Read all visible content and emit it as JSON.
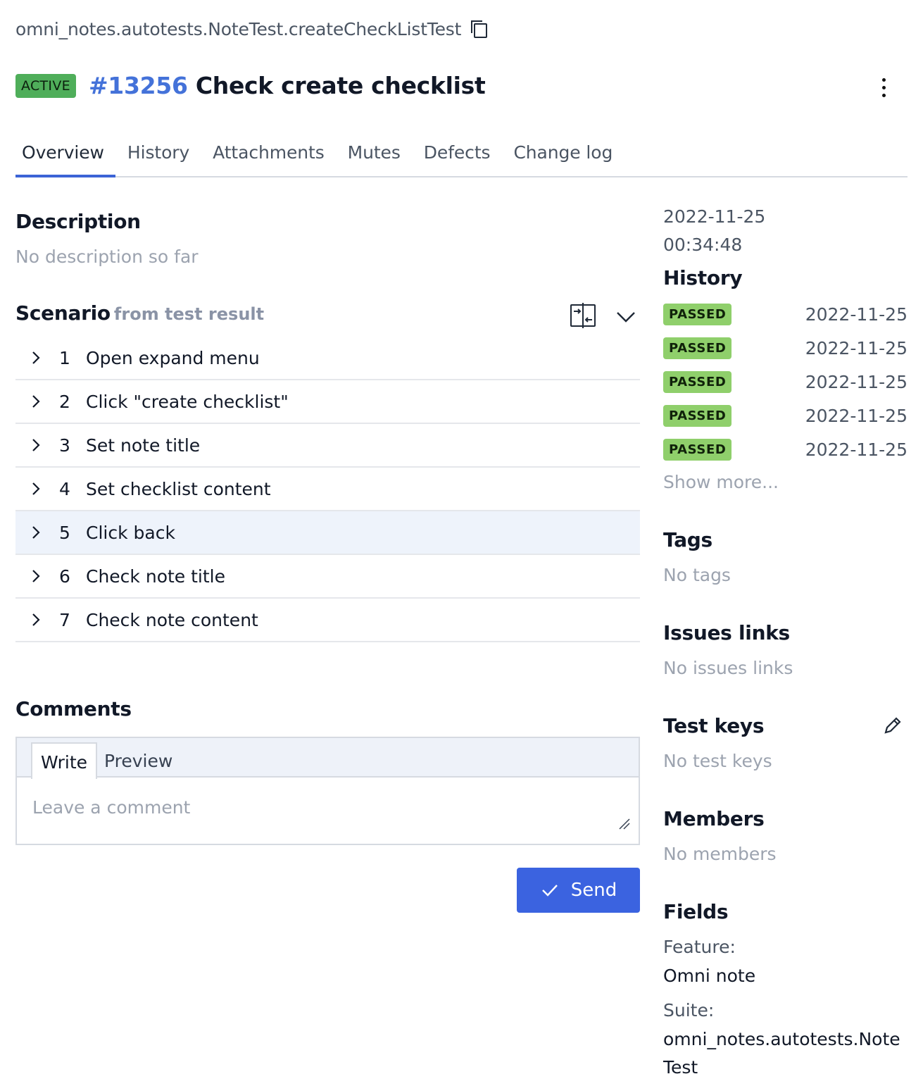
{
  "breadcrumb": {
    "path": "omni_notes.autotests.NoteTest.createCheckListTest",
    "copy_icon": "copy-icon"
  },
  "header": {
    "status": "ACTIVE",
    "id": "#13256",
    "title": "Check create checklist",
    "menu_icon": "more-vertical-icon"
  },
  "tabs": [
    "Overview",
    "History",
    "Attachments",
    "Mutes",
    "Defects",
    "Change log"
  ],
  "active_tab": "Overview",
  "description": {
    "title": "Description",
    "empty": "No description so far"
  },
  "scenario": {
    "title": "Scenario",
    "subtitle": "from test result",
    "steps": [
      {
        "num": "1",
        "label": "Open expand menu"
      },
      {
        "num": "2",
        "label": "Click \"create checklist\""
      },
      {
        "num": "3",
        "label": "Set note title"
      },
      {
        "num": "4",
        "label": "Set checklist content"
      },
      {
        "num": "5",
        "label": "Click back"
      },
      {
        "num": "6",
        "label": "Check note title"
      },
      {
        "num": "7",
        "label": "Check note content"
      }
    ],
    "highlighted_step": "5"
  },
  "comments": {
    "title": "Comments",
    "write_tab": "Write",
    "preview_tab": "Preview",
    "placeholder": "Leave a comment",
    "send_label": "Send"
  },
  "sidebar": {
    "timestamp_date": "2022-11-25",
    "timestamp_time": "00:34:48",
    "history": {
      "title": "History",
      "items": [
        {
          "status": "PASSED",
          "date": "2022-11-25"
        },
        {
          "status": "PASSED",
          "date": "2022-11-25"
        },
        {
          "status": "PASSED",
          "date": "2022-11-25"
        },
        {
          "status": "PASSED",
          "date": "2022-11-25"
        },
        {
          "status": "PASSED",
          "date": "2022-11-25"
        }
      ],
      "show_more": "Show more..."
    },
    "tags": {
      "title": "Tags",
      "empty": "No tags"
    },
    "issues": {
      "title": "Issues links",
      "empty": "No issues links"
    },
    "test_keys": {
      "title": "Test keys",
      "empty": "No test keys"
    },
    "members": {
      "title": "Members",
      "empty": "No members"
    },
    "fields": {
      "title": "Fields",
      "feature_label": "Feature:",
      "feature_value": "Omni note",
      "suite_label": "Suite:",
      "suite_value_line1": "omni_notes.autotests.Note",
      "suite_value_line2": "Test"
    }
  },
  "colors": {
    "accent": "#3b63e0",
    "active_badge": "#4fae5a",
    "passed_badge": "#8fcf6b",
    "id_link": "#4472d9"
  }
}
